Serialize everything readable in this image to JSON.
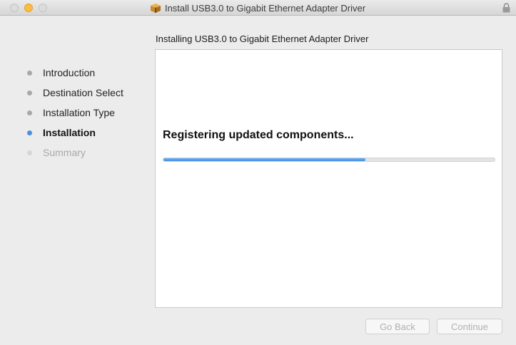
{
  "window": {
    "title": "Install USB3.0 to Gigabit Ethernet Adapter Driver",
    "controls": [
      "close",
      "minimize",
      "zoom"
    ]
  },
  "header": {
    "subtitle": "Installing USB3.0 to Gigabit Ethernet Adapter Driver"
  },
  "sidebar": {
    "steps": [
      {
        "label": "Introduction",
        "state": "done"
      },
      {
        "label": "Destination Select",
        "state": "done"
      },
      {
        "label": "Installation Type",
        "state": "done"
      },
      {
        "label": "Installation",
        "state": "active"
      },
      {
        "label": "Summary",
        "state": "pending"
      }
    ]
  },
  "main": {
    "status_text": "Registering updated components...",
    "progress_fraction": 0.61
  },
  "footer": {
    "back_label": "Go Back",
    "continue_label": "Continue",
    "back_enabled": false,
    "continue_enabled": false
  },
  "icons": {
    "title_icon": "package-icon",
    "lock_icon": "lock-icon"
  },
  "colors": {
    "accent": "#4a90e2",
    "progress": "#3f8ee6",
    "minimize_light": "#fdbc40"
  }
}
